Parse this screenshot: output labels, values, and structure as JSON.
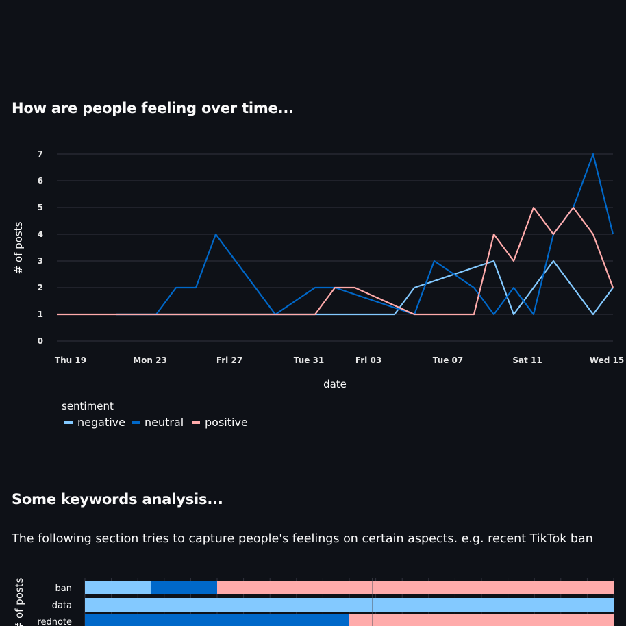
{
  "sections": {
    "feelings_title": "How are people feeling over time...",
    "keywords_title": "Some keywords analysis...",
    "keywords_description": "The following section tries to capture people's feelings on certain aspects. e.g. recent TikTok ban"
  },
  "colors": {
    "background": "#0e1117",
    "grid": "#31333f",
    "negative": "#83c9ff",
    "neutral": "#0068c9",
    "positive": "#ffabab"
  },
  "chart_data": [
    {
      "type": "line",
      "title": "",
      "xlabel": "date",
      "ylabel": "# of posts",
      "ylim": [
        0,
        7
      ],
      "yticks": [
        0,
        1,
        2,
        3,
        4,
        5,
        6,
        7
      ],
      "x_tick_labels": [
        "Thu 19",
        "Mon 23",
        "Fri 27",
        "Tue 31",
        "Fri 03",
        "Tue 07",
        "Sat 11",
        "Wed 15"
      ],
      "x_tick_dates": [
        "2024-12-19",
        "2024-12-23",
        "2024-12-27",
        "2024-12-31",
        "2025-01-03",
        "2025-01-07",
        "2025-01-11",
        "2025-01-15"
      ],
      "x_range": [
        "2024-12-19",
        "2025-01-16"
      ],
      "grid": true,
      "legend": {
        "title": "sentiment",
        "placement": "bottom-left"
      },
      "series": [
        {
          "name": "negative",
          "color": "#83c9ff",
          "points": [
            [
              "2024-12-22",
              1
            ],
            [
              "2024-12-23",
              1
            ],
            [
              "2024-12-24",
              1
            ],
            [
              "2024-12-27",
              1
            ],
            [
              "2024-12-30",
              1
            ],
            [
              "2025-01-03",
              1
            ],
            [
              "2025-01-05",
              1
            ],
            [
              "2025-01-06",
              2
            ],
            [
              "2025-01-10",
              3
            ],
            [
              "2025-01-11",
              1
            ],
            [
              "2025-01-13",
              3
            ],
            [
              "2025-01-15",
              1
            ],
            [
              "2025-01-16",
              2
            ]
          ]
        },
        {
          "name": "neutral",
          "color": "#0068c9",
          "points": [
            [
              "2024-12-22",
              1
            ],
            [
              "2024-12-24",
              1
            ],
            [
              "2024-12-25",
              2
            ],
            [
              "2024-12-26",
              2
            ],
            [
              "2024-12-27",
              4
            ],
            [
              "2024-12-30",
              1
            ],
            [
              "2025-01-01",
              2
            ],
            [
              "2025-01-02",
              2
            ],
            [
              "2025-01-06",
              1
            ],
            [
              "2025-01-07",
              3
            ],
            [
              "2025-01-09",
              2
            ],
            [
              "2025-01-10",
              1
            ],
            [
              "2025-01-11",
              2
            ],
            [
              "2025-01-12",
              1
            ],
            [
              "2025-01-13",
              4
            ],
            [
              "2025-01-14",
              5
            ],
            [
              "2025-01-15",
              7
            ],
            [
              "2025-01-16",
              4
            ]
          ]
        },
        {
          "name": "positive",
          "color": "#ffabab",
          "points": [
            [
              "2024-12-19",
              1
            ],
            [
              "2024-12-22",
              1
            ],
            [
              "2025-01-01",
              1
            ],
            [
              "2025-01-02",
              2
            ],
            [
              "2025-01-03",
              2
            ],
            [
              "2025-01-06",
              1
            ],
            [
              "2025-01-09",
              1
            ],
            [
              "2025-01-10",
              4
            ],
            [
              "2025-01-11",
              3
            ],
            [
              "2025-01-12",
              5
            ],
            [
              "2025-01-13",
              4
            ],
            [
              "2025-01-14",
              5
            ],
            [
              "2025-01-15",
              4
            ],
            [
              "2025-01-16",
              2
            ]
          ]
        }
      ]
    },
    {
      "type": "bar",
      "orientation": "horizontal",
      "stacked": "normalized",
      "ylabel": "# of posts",
      "categories": [
        "ban",
        "data",
        "rednote"
      ],
      "series": [
        {
          "name": "negative",
          "color": "#83c9ff",
          "values": [
            0.125,
            1.0,
            0.0
          ]
        },
        {
          "name": "neutral",
          "color": "#0068c9",
          "values": [
            0.125,
            0.0,
            0.5
          ]
        },
        {
          "name": "positive",
          "color": "#ffabab",
          "values": [
            0.75,
            0.0,
            0.5
          ]
        }
      ]
    }
  ]
}
